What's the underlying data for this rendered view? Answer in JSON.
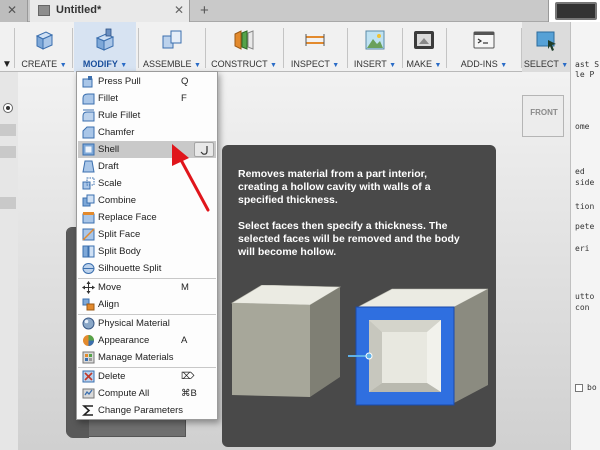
{
  "tabs": {
    "document_title": "Untitled*",
    "close_glyph": "✕",
    "new_glyph": "+"
  },
  "toolbar": {
    "groups": [
      {
        "label": "CREATE",
        "icon": "create-box-icon"
      },
      {
        "label": "MODIFY",
        "icon": "modify-push-pull-icon",
        "active": true
      },
      {
        "label": "ASSEMBLE",
        "icon": "assemble-icon"
      },
      {
        "label": "CONSTRUCT",
        "icon": "construct-plane-icon"
      },
      {
        "label": "INSPECT",
        "icon": "inspect-measure-icon"
      },
      {
        "label": "INSERT",
        "icon": "insert-image-icon"
      },
      {
        "label": "MAKE",
        "icon": "make-print-icon"
      },
      {
        "label": "ADD-INS",
        "icon": "add-ins-script-icon"
      },
      {
        "label": "SELECT",
        "icon": "select-window-icon"
      }
    ],
    "caret": "▼"
  },
  "menu": {
    "items": [
      {
        "label": "Press Pull",
        "shortcut": "Q",
        "icon": "press-pull-icon"
      },
      {
        "label": "Fillet",
        "shortcut": "F",
        "icon": "fillet-icon"
      },
      {
        "label": "Rule Fillet",
        "shortcut": "",
        "icon": "rule-fillet-icon"
      },
      {
        "label": "Chamfer",
        "shortcut": "",
        "icon": "chamfer-icon"
      },
      {
        "label": "Shell",
        "shortcut": "",
        "icon": "shell-icon",
        "highlighted": true
      },
      {
        "label": "Draft",
        "shortcut": "",
        "icon": "draft-icon"
      },
      {
        "label": "Scale",
        "shortcut": "",
        "icon": "scale-icon"
      },
      {
        "label": "Combine",
        "shortcut": "",
        "icon": "combine-icon"
      },
      {
        "label": "Replace Face",
        "shortcut": "",
        "icon": "replace-face-icon"
      },
      {
        "label": "Split Face",
        "shortcut": "",
        "icon": "split-face-icon"
      },
      {
        "label": "Split Body",
        "shortcut": "",
        "icon": "split-body-icon"
      },
      {
        "label": "Silhouette Split",
        "shortcut": "",
        "icon": "silhouette-split-icon"
      },
      {
        "label": "Move",
        "shortcut": "M",
        "icon": "move-icon"
      },
      {
        "label": "Align",
        "shortcut": "",
        "icon": "align-icon"
      },
      {
        "label": "Physical Material",
        "shortcut": "",
        "icon": "physical-material-icon"
      },
      {
        "label": "Appearance",
        "shortcut": "A",
        "icon": "appearance-icon"
      },
      {
        "label": "Manage Materials",
        "shortcut": "",
        "icon": "manage-materials-icon"
      },
      {
        "label": "Delete",
        "shortcut": "⌦",
        "icon": "delete-icon"
      },
      {
        "label": "Compute All",
        "shortcut": "⌘B",
        "icon": "compute-all-icon"
      },
      {
        "label": "Change Parameters",
        "shortcut": "",
        "icon": "change-parameters-icon"
      }
    ]
  },
  "tooltip": {
    "description": "Removes material from a part interior, creating a hollow cavity with walls of a specified thickness.",
    "instructions": "Select faces then specify a thickness. The selected faces will be removed and the body will become hollow."
  },
  "viewcube": {
    "face": "FRONT"
  },
  "right_panel": {
    "lines": [
      "ast S",
      "le P",
      "ome",
      "ed",
      "side",
      "tion",
      "pete",
      "eri",
      "utto",
      "con",
      "bo"
    ]
  },
  "colors": {
    "accent": "#2a6cc7",
    "tooltip_bg": "#494949",
    "shell_face": "#2f6fe0",
    "annotation_arrow": "#e0161c"
  }
}
